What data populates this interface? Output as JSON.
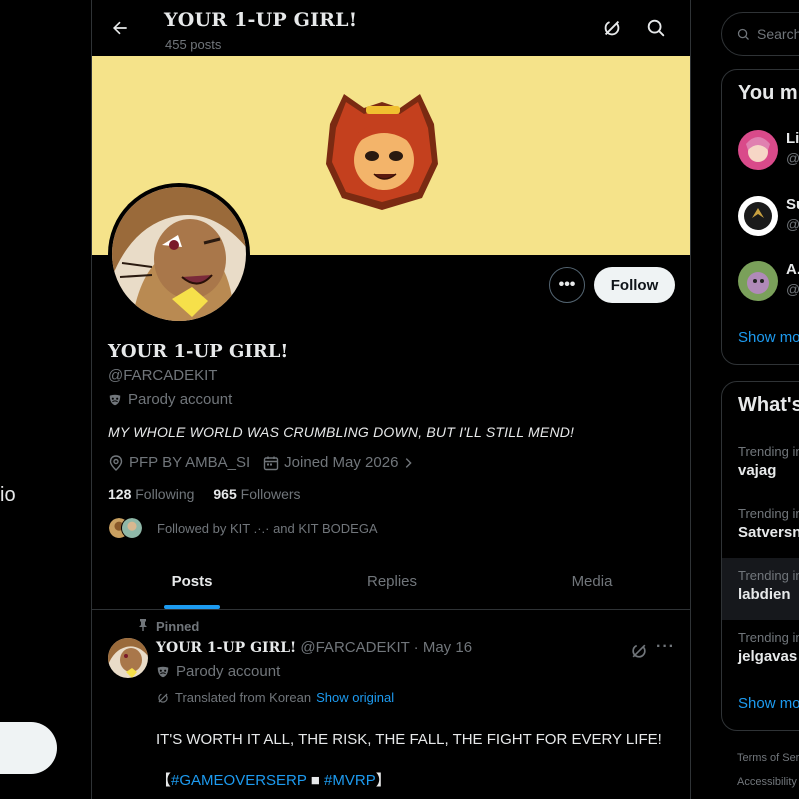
{
  "left": {
    "partial_text": "io"
  },
  "header": {
    "title": "YOUR 1-UP GIRL!",
    "post_count": "455 posts"
  },
  "profile": {
    "name": "YOUR 1-UP GIRL!",
    "handle": "@FARCADEKIT",
    "parody_label": "Parody account",
    "bio": "MY WHOLE WORLD WAS CRUMBLING DOWN, BUT I'LL STILL MEND!",
    "location": "PFP BY AMBA_SI",
    "joined": "Joined May 2026",
    "following_count": "128",
    "following_label": "Following",
    "followers_count": "965",
    "followers_label": "Followers",
    "followed_by": "Followed by KIT .·.· and KIT BODEGA",
    "follow_button": "Follow",
    "banner_color": "#f5e38a"
  },
  "tabs": [
    "Posts",
    "Replies",
    "Media"
  ],
  "post": {
    "pinned_label": "Pinned",
    "author_name": "YOUR 1-UP GIRL!",
    "author_meta": "@FARCADEKIT · May 16",
    "parody_label": "Parody account",
    "translated": "Translated from Korean",
    "show_original": "Show original",
    "text": "IT'S WORTH IT ALL, THE RISK, THE FALL, THE FIGHT FOR EVERY LIFE!",
    "tag_open": "【",
    "tag1": "#GAMEOVERSERP",
    "tag_sep": " ■ ",
    "tag2": "#MVRP",
    "tag_close": "】"
  },
  "sidebar": {
    "search_placeholder": "Search",
    "you_might_like_title": "You m",
    "suggestions": [
      {
        "name": "Li",
        "handle": "@"
      },
      {
        "name": "Su",
        "handle": "@"
      },
      {
        "name": "A.",
        "handle": "@"
      }
    ],
    "show_more_1": "Show mo",
    "whats_title": "What's",
    "trends": [
      {
        "label": "Trending in",
        "title": "vajag"
      },
      {
        "label": "Trending in",
        "title": "Satversn"
      },
      {
        "label": "Trending in",
        "title": "labdien"
      },
      {
        "label": "Trending in",
        "title": "jelgavas"
      }
    ],
    "show_more_2": "Show mo",
    "footer_1": "Terms of Ser",
    "footer_2": "Accessibility"
  },
  "colors": {
    "accent": "#1d9bf0",
    "muted": "#71767b",
    "text": "#e7e9ea",
    "background": "#000000"
  }
}
